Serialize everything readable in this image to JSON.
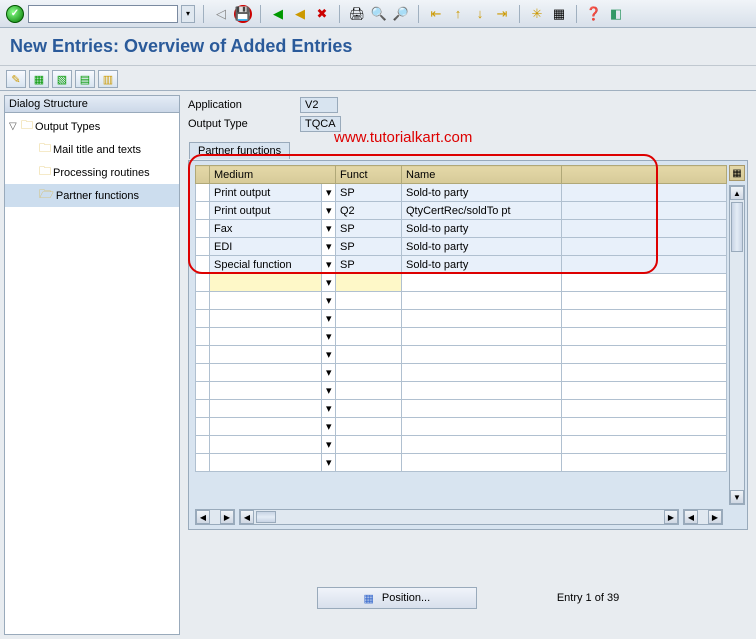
{
  "title": "New Entries: Overview of Added Entries",
  "watermark": "www.tutorialkart.com",
  "fields": {
    "application": {
      "label": "Application",
      "value": "V2"
    },
    "output_type": {
      "label": "Output Type",
      "value": "TQCA"
    }
  },
  "tree": {
    "header": "Dialog Structure",
    "root": "Output Types",
    "items": [
      "Mail title and texts",
      "Processing routines",
      "Partner functions"
    ]
  },
  "table": {
    "tab": "Partner functions",
    "cols": {
      "medium": "Medium",
      "funct": "Funct",
      "name": "Name"
    },
    "rows": [
      {
        "medium": "Print output",
        "funct": "SP",
        "name": "Sold-to party"
      },
      {
        "medium": "Print output",
        "funct": "Q2",
        "name": "QtyCertRec/soldTo pt"
      },
      {
        "medium": "Fax",
        "funct": "SP",
        "name": "Sold-to party"
      },
      {
        "medium": "EDI",
        "funct": "SP",
        "name": "Sold-to party"
      },
      {
        "medium": "Special function",
        "funct": "SP",
        "name": "Sold-to party"
      }
    ]
  },
  "footer": {
    "position": "Position...",
    "entry": "Entry 1 of 39"
  },
  "icons": {
    "back": "◁",
    "save": "💾",
    "green_back": "⬅",
    "green_up": "⬆",
    "cancel": "✖",
    "print": "🖨",
    "find": "🔍",
    "findnext": "🔎",
    "first": "⏮",
    "pgup": "⏫",
    "pgdn": "⏬",
    "last": "⏭",
    "new": "✳",
    "layout": "▦",
    "help": "❓",
    "local": "📋"
  }
}
